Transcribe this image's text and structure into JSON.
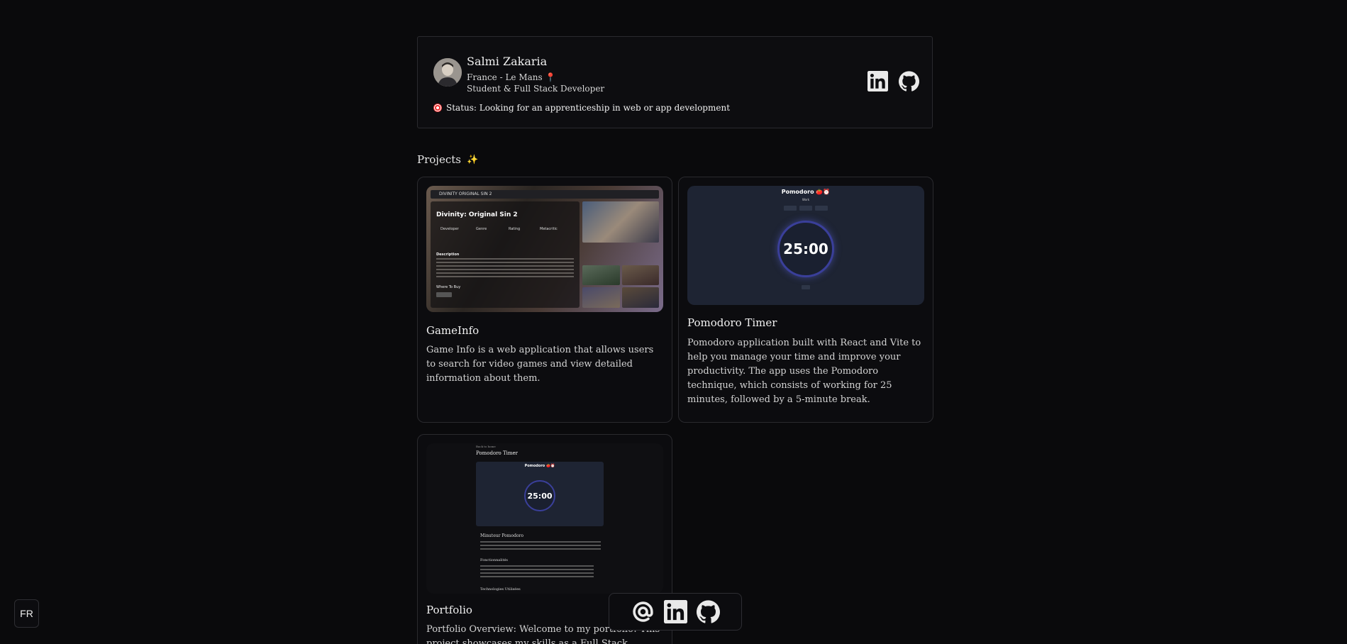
{
  "profile": {
    "name": "Salmi Zakaria",
    "location": "France - Le Mans 📍",
    "role": "Student & Full Stack Developer",
    "status": "Status: Looking for an apprenticeship in web or app development"
  },
  "section": {
    "title": "Projects",
    "sparkle": "✨"
  },
  "projects": [
    {
      "title": "GameInfo",
      "description": "Game Info is a web application that allows users to search for video games and view detailed information about them.",
      "thumb": {
        "bar": "DIVINITY ORIGINAL SIN 2",
        "game_title": "Divinity: Original Sin 2",
        "developer": "Developer",
        "genre": "Genre",
        "rating": "Rating",
        "metacritic": "Metacritic",
        "description_heading": "Description",
        "where_to_buy": "Where To Buy"
      }
    },
    {
      "title": "Pomodoro Timer",
      "description": "Pomodoro application built with React and Vite to help you manage your time and improve your productivity. The app uses the Pomodoro technique, which consists of working for 25 minutes, followed by a 5-minute break.",
      "thumb": {
        "title": "Pomodoro 🍅⏰",
        "subtitle": "Work",
        "timer": "25:00"
      }
    },
    {
      "title": "Portfolio",
      "description": "Portfolio Overview: Welcome to my portfolio! This project showcases my skills as a Full Stack Developer",
      "thumb": {
        "back": "Back to home",
        "heading": "Pomodoro Timer",
        "frame_title": "Pomodoro 🍅⏰",
        "timer": "25:00",
        "section1": "Minuteur Pomodoro",
        "section2": "Fonctionnalités",
        "section3": "Technologies Utilisées"
      }
    }
  ],
  "icons": {
    "linkedin": "linkedin-icon",
    "github": "github-icon",
    "email": "at-sign-icon",
    "status": "target-icon"
  },
  "language_toggle": "FR"
}
